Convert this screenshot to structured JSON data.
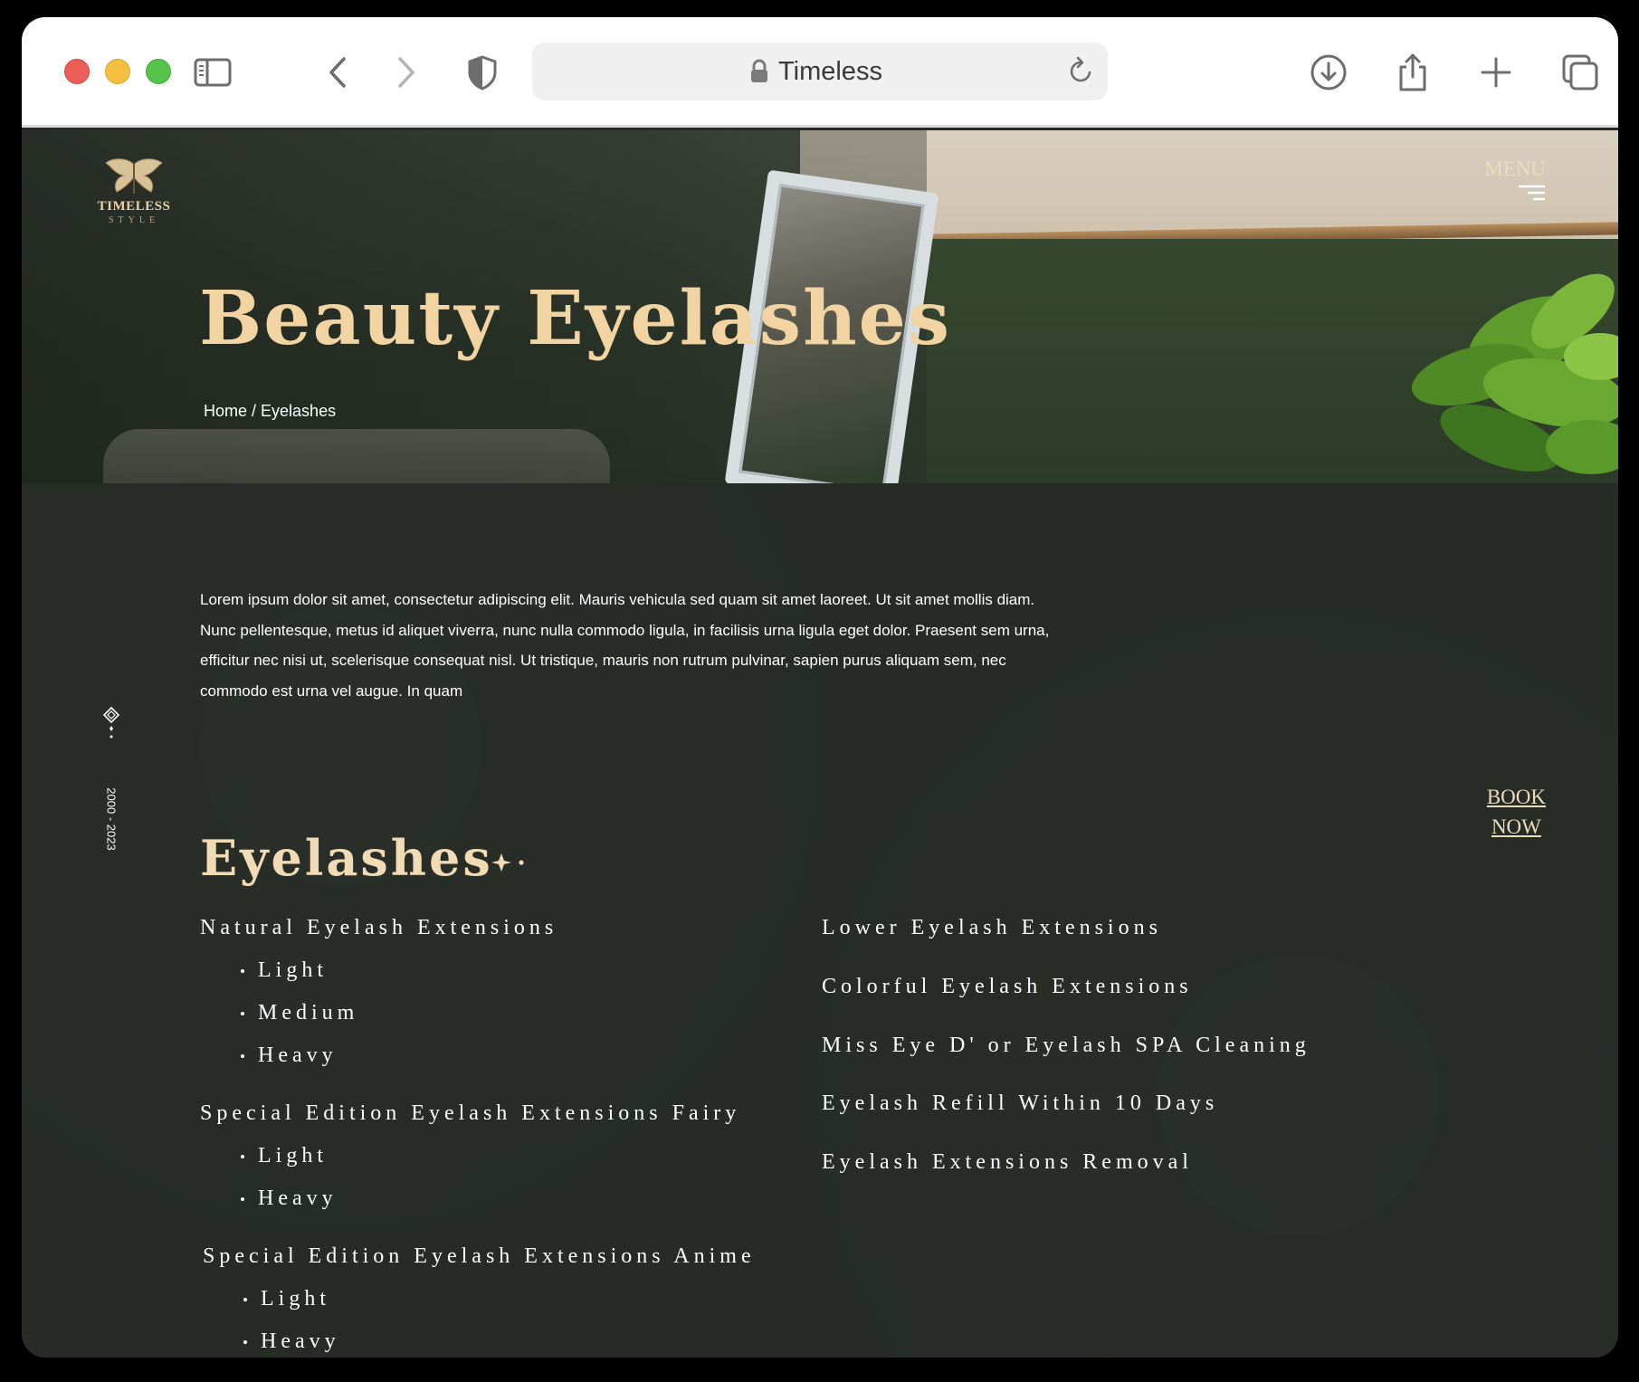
{
  "browser": {
    "url_label": "Timeless",
    "icons": [
      "sidebar-icon",
      "back-icon",
      "forward-icon",
      "shield-icon",
      "lock-icon",
      "reload-icon",
      "download-icon",
      "share-icon",
      "new-tab-icon",
      "tabs-icon"
    ]
  },
  "header": {
    "logo_brand": "TIMELESS",
    "logo_sub": "STYLE",
    "menu_label": "MENU"
  },
  "hero": {
    "title": "Beauty Eyelashes",
    "breadcrumb_home": "Home",
    "breadcrumb_sep": " / ",
    "breadcrumb_current": "Eyelashes"
  },
  "intro": {
    "line1": "Lorem ipsum dolor sit amet, consectetur adipiscing elit. Mauris vehicula sed quam sit amet laoreet. Ut sit amet mollis diam.",
    "line2": "Nunc pellentesque, metus id aliquet viverra, nunc nulla commodo ligula, in facilisis urna ligula eget dolor. Praesent sem urna,",
    "line3": "efficitur nec nisi ut, scelerisque consequat nisl. Ut tristique, mauris non rutrum pulvinar, sapien purus aliquam sem, nec",
    "line4": "commodo est urna vel augue. In quam"
  },
  "side_rail": {
    "years": "2000 - 2023"
  },
  "book_now": {
    "line1": "BOOK",
    "line2": "NOW"
  },
  "section": {
    "title": "Eyelashes"
  },
  "services": {
    "left": [
      {
        "name": "Natural Eyelash Extensions",
        "options": [
          "Light",
          "Medium",
          "Heavy"
        ]
      },
      {
        "name": "Special Edition Eyelash Extensions Fairy",
        "options": [
          "Light",
          "Heavy"
        ]
      },
      {
        "name": "Special Edition Eyelash Extensions Anime",
        "options": [
          "Light",
          "Heavy"
        ]
      }
    ],
    "right": [
      "Lower Eyelash Extensions",
      "Colorful Eyelash Extensions",
      "Miss Eye D' or Eyelash SPA Cleaning",
      "Eyelash Refill Within 10 Days",
      "Eyelash Extensions Removal"
    ]
  },
  "colors": {
    "accent_gold": "#f1d4a2",
    "background_green": "#262b26",
    "text_white": "#ffffff"
  }
}
